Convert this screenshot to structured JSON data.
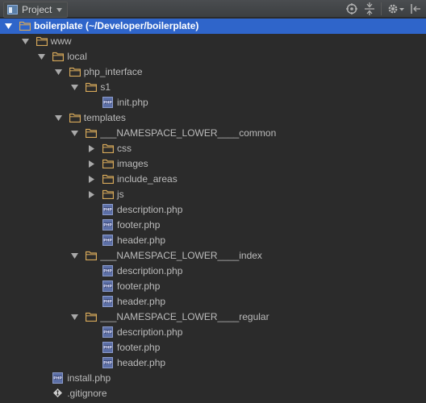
{
  "toolbar": {
    "view_selector_label": "Project",
    "icons": [
      "target-icon",
      "collapse-all-icon",
      "settings-icon",
      "hide-icon"
    ]
  },
  "colors": {
    "background": "#2b2b2b",
    "selection": "#2f65ca",
    "folder": "#d7a95a",
    "text": "#bbbbbb"
  },
  "tree": {
    "root_name": "boilerplate",
    "root_path": "(~/Developer/boilerplate)",
    "www": "www",
    "local": "local",
    "php_interface": "php_interface",
    "s1": "s1",
    "init_php": "init.php",
    "templates": "templates",
    "common": "___NAMESPACE_LOWER____common",
    "css": "css",
    "images": "images",
    "include_areas": "include_areas",
    "js": "js",
    "common_description": "description.php",
    "common_footer": "footer.php",
    "common_header": "header.php",
    "index": "___NAMESPACE_LOWER____index",
    "index_description": "description.php",
    "index_footer": "footer.php",
    "index_header": "header.php",
    "regular": "___NAMESPACE_LOWER____regular",
    "regular_description": "description.php",
    "regular_footer": "footer.php",
    "regular_header": "header.php",
    "install_php": "install.php",
    "gitignore": ".gitignore"
  }
}
